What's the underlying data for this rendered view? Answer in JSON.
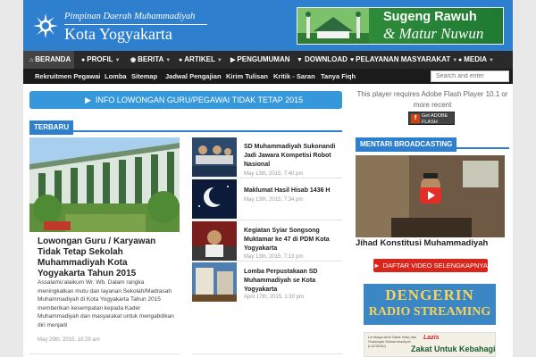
{
  "header": {
    "logo_line1": "Pimpinan Daerah Muhammadiyah",
    "logo_line2": "Kota Yogyakarta",
    "banner_line1": "Sugeng Rawuh",
    "banner_line2": "& Matur Nuwun"
  },
  "nav": {
    "items": [
      {
        "label": "BERANDA",
        "icon": "home-icon"
      },
      {
        "label": "PROFIL",
        "icon": "users-icon"
      },
      {
        "label": "BERITA",
        "icon": "globe-icon"
      },
      {
        "label": "ARTIKEL",
        "icon": "lightbulb-icon"
      },
      {
        "label": "PENGUMUMAN",
        "icon": "megaphone-icon"
      },
      {
        "label": "DOWNLOAD",
        "icon": "download-icon"
      },
      {
        "label": "PELAYANAN MASYARAKAT",
        "icon": "heart-icon"
      },
      {
        "label": "MEDIA",
        "icon": "microphone-icon"
      }
    ]
  },
  "subnav": {
    "items": [
      "Rekruitmen Pegawai",
      "Lomba",
      "Sitemap",
      "Jadwal Pengajian",
      "Kirim Tulisan",
      "Kritik - Saran",
      "Tanya Fiqh"
    ]
  },
  "search": {
    "placeholder": "Search and enter"
  },
  "info_bar": {
    "label": "INFO LOWONGAN GURU/PEGAWAI TIDAK TETAP 2015"
  },
  "flash": {
    "message": "This player requires Adobe Flash Player 10.1 or more recent",
    "badge_line1": "Get ADOBE",
    "badge_line2": "FLASH PLAYER"
  },
  "terbaru": {
    "heading": "TERBARU",
    "featured": {
      "title": "Lowongan Guru / Karyawan Tidak Tetap Sekolah Muhammadiyah Kota Yogyakarta Tahun 2015",
      "excerpt": "Assalamu'alaikum Wr. Wb. Dalam rangka meningkatkan mutu dan layanan Sekolah/Madrasah Muhammadiyah di Kota Yogyakarta Tahun 2015 memberikan kesempatan kepada Kader Muhammadiyah dan masyarakat untuk mengabdikan diri menjadi",
      "date": "May 29th, 2015, 10:29 am"
    },
    "list": [
      {
        "title": "SD Muhammadiyah Sukonandi Jadi Jawara Kompetisi Robot Nasional",
        "date": "May 13th, 2015, 7:40 pm"
      },
      {
        "title": "Maklumat Hasil Hisab 1436 H",
        "date": "May 13th, 2015, 7:34 pm"
      },
      {
        "title": "Kegiatan Syiar Songsong Muktamar ke 47 di PDM Kota Yogyakarta",
        "date": "May 13th, 2015, 7:13 pm"
      },
      {
        "title": "Lomba Perpustakaan SD Muhammadiyah se Kota Yogyakarta",
        "date": "April 17th, 2015, 1:30 pm"
      }
    ]
  },
  "broadcast": {
    "heading": "MENTARI BROADCASTING",
    "video_title": "Jihad Konstitusi Muhammadiyah",
    "button_label": "DAFTAR VIDEO SELENGKAPNYA"
  },
  "radio": {
    "line1": "DENGERIN",
    "line2": "RADIO STREAMING"
  },
  "zakat": {
    "small_text": "Lembaga Amil Zakat Infaq dan Shadaqah Muhammadiyah (LAZISMU)",
    "logo": "Lazis",
    "title": "Zakat Untuk Kebahagiaan"
  },
  "colors": {
    "brand_blue": "#2f7fcf",
    "nav_dark": "#2a2a2a",
    "button_red": "#d9261c",
    "info_blue": "#3598db"
  }
}
